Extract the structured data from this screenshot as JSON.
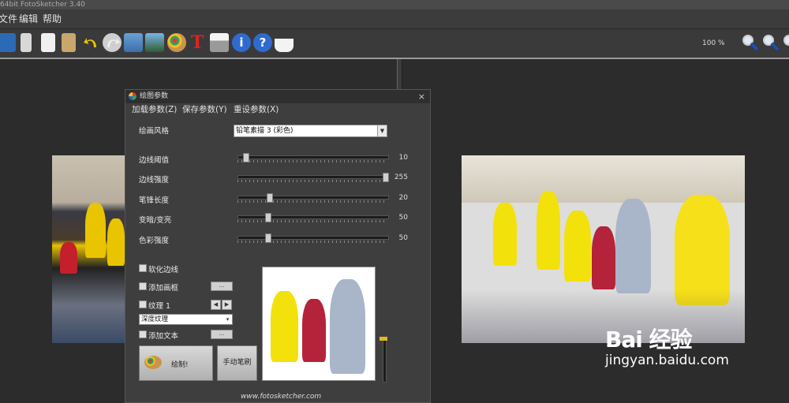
{
  "window": {
    "title": "64bit FotoSketcher 3.40"
  },
  "menu": [
    "文件",
    "编辑",
    "帮助"
  ],
  "toolbar": {
    "icons": [
      "open-icon",
      "save-icon",
      "copy-icon",
      "paste-icon",
      "undo-icon",
      "redo-icon",
      "image-icon",
      "landscape-icon",
      "palette-icon",
      "text-icon",
      "print-icon",
      "info-icon",
      "help-icon",
      "coffee-icon"
    ],
    "zoom": "100 %",
    "zoom_icons": [
      "zoom-in-icon",
      "zoom-out-icon",
      "zoom-fit-icon"
    ]
  },
  "dialog": {
    "title": "绘图参数",
    "close": "×",
    "menu": [
      "加载参数(Z)",
      "保存参数(Y)",
      "重设参数(X)"
    ],
    "style_label": "绘画风格",
    "style_value": "铅笔素描 3 (彩色)",
    "sliders": [
      {
        "label": "边线阈值",
        "value": "10",
        "fraction": 0.04
      },
      {
        "label": "边线强度",
        "value": "255",
        "fraction": 1.0
      },
      {
        "label": "笔锋长度",
        "value": "20",
        "fraction": 0.2
      },
      {
        "label": "变暗/变亮",
        "value": "50",
        "fraction": 0.19
      },
      {
        "label": "色彩强度",
        "value": "50",
        "fraction": 0.19
      }
    ],
    "checkboxes": {
      "soften_edges": "软化边线",
      "add_frame": "添加画框",
      "texture": "纹理 1",
      "add_text": "添加文本"
    },
    "ellipsis": "...",
    "texture_value": "深度纹理",
    "draw_button": "绘制!",
    "manual_brush_button": "手动笔刷",
    "footer": "www.fotosketcher.com"
  },
  "watermark": {
    "line1": "Bai 经验",
    "line2": "jingyan.baidu.com"
  }
}
